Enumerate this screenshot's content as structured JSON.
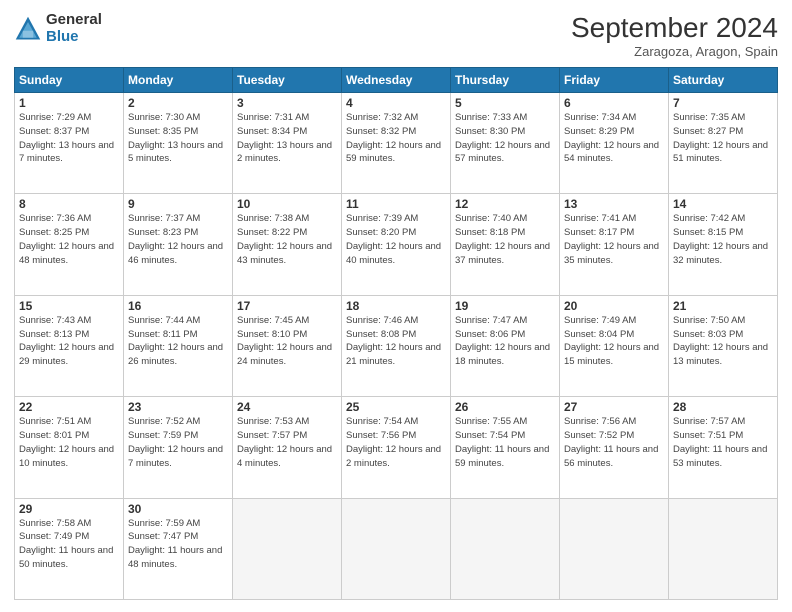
{
  "header": {
    "logo_general": "General",
    "logo_blue": "Blue",
    "month_title": "September 2024",
    "location": "Zaragoza, Aragon, Spain"
  },
  "weekdays": [
    "Sunday",
    "Monday",
    "Tuesday",
    "Wednesday",
    "Thursday",
    "Friday",
    "Saturday"
  ],
  "weeks": [
    [
      {
        "day": "1",
        "sunrise": "7:29 AM",
        "sunset": "8:37 PM",
        "daylight": "13 hours and 7 minutes."
      },
      {
        "day": "2",
        "sunrise": "7:30 AM",
        "sunset": "8:35 PM",
        "daylight": "13 hours and 5 minutes."
      },
      {
        "day": "3",
        "sunrise": "7:31 AM",
        "sunset": "8:34 PM",
        "daylight": "13 hours and 2 minutes."
      },
      {
        "day": "4",
        "sunrise": "7:32 AM",
        "sunset": "8:32 PM",
        "daylight": "12 hours and 59 minutes."
      },
      {
        "day": "5",
        "sunrise": "7:33 AM",
        "sunset": "8:30 PM",
        "daylight": "12 hours and 57 minutes."
      },
      {
        "day": "6",
        "sunrise": "7:34 AM",
        "sunset": "8:29 PM",
        "daylight": "12 hours and 54 minutes."
      },
      {
        "day": "7",
        "sunrise": "7:35 AM",
        "sunset": "8:27 PM",
        "daylight": "12 hours and 51 minutes."
      }
    ],
    [
      {
        "day": "8",
        "sunrise": "7:36 AM",
        "sunset": "8:25 PM",
        "daylight": "12 hours and 48 minutes."
      },
      {
        "day": "9",
        "sunrise": "7:37 AM",
        "sunset": "8:23 PM",
        "daylight": "12 hours and 46 minutes."
      },
      {
        "day": "10",
        "sunrise": "7:38 AM",
        "sunset": "8:22 PM",
        "daylight": "12 hours and 43 minutes."
      },
      {
        "day": "11",
        "sunrise": "7:39 AM",
        "sunset": "8:20 PM",
        "daylight": "12 hours and 40 minutes."
      },
      {
        "day": "12",
        "sunrise": "7:40 AM",
        "sunset": "8:18 PM",
        "daylight": "12 hours and 37 minutes."
      },
      {
        "day": "13",
        "sunrise": "7:41 AM",
        "sunset": "8:17 PM",
        "daylight": "12 hours and 35 minutes."
      },
      {
        "day": "14",
        "sunrise": "7:42 AM",
        "sunset": "8:15 PM",
        "daylight": "12 hours and 32 minutes."
      }
    ],
    [
      {
        "day": "15",
        "sunrise": "7:43 AM",
        "sunset": "8:13 PM",
        "daylight": "12 hours and 29 minutes."
      },
      {
        "day": "16",
        "sunrise": "7:44 AM",
        "sunset": "8:11 PM",
        "daylight": "12 hours and 26 minutes."
      },
      {
        "day": "17",
        "sunrise": "7:45 AM",
        "sunset": "8:10 PM",
        "daylight": "12 hours and 24 minutes."
      },
      {
        "day": "18",
        "sunrise": "7:46 AM",
        "sunset": "8:08 PM",
        "daylight": "12 hours and 21 minutes."
      },
      {
        "day": "19",
        "sunrise": "7:47 AM",
        "sunset": "8:06 PM",
        "daylight": "12 hours and 18 minutes."
      },
      {
        "day": "20",
        "sunrise": "7:49 AM",
        "sunset": "8:04 PM",
        "daylight": "12 hours and 15 minutes."
      },
      {
        "day": "21",
        "sunrise": "7:50 AM",
        "sunset": "8:03 PM",
        "daylight": "12 hours and 13 minutes."
      }
    ],
    [
      {
        "day": "22",
        "sunrise": "7:51 AM",
        "sunset": "8:01 PM",
        "daylight": "12 hours and 10 minutes."
      },
      {
        "day": "23",
        "sunrise": "7:52 AM",
        "sunset": "7:59 PM",
        "daylight": "12 hours and 7 minutes."
      },
      {
        "day": "24",
        "sunrise": "7:53 AM",
        "sunset": "7:57 PM",
        "daylight": "12 hours and 4 minutes."
      },
      {
        "day": "25",
        "sunrise": "7:54 AM",
        "sunset": "7:56 PM",
        "daylight": "12 hours and 2 minutes."
      },
      {
        "day": "26",
        "sunrise": "7:55 AM",
        "sunset": "7:54 PM",
        "daylight": "11 hours and 59 minutes."
      },
      {
        "day": "27",
        "sunrise": "7:56 AM",
        "sunset": "7:52 PM",
        "daylight": "11 hours and 56 minutes."
      },
      {
        "day": "28",
        "sunrise": "7:57 AM",
        "sunset": "7:51 PM",
        "daylight": "11 hours and 53 minutes."
      }
    ],
    [
      {
        "day": "29",
        "sunrise": "7:58 AM",
        "sunset": "7:49 PM",
        "daylight": "11 hours and 50 minutes."
      },
      {
        "day": "30",
        "sunrise": "7:59 AM",
        "sunset": "7:47 PM",
        "daylight": "11 hours and 48 minutes."
      },
      null,
      null,
      null,
      null,
      null
    ]
  ]
}
